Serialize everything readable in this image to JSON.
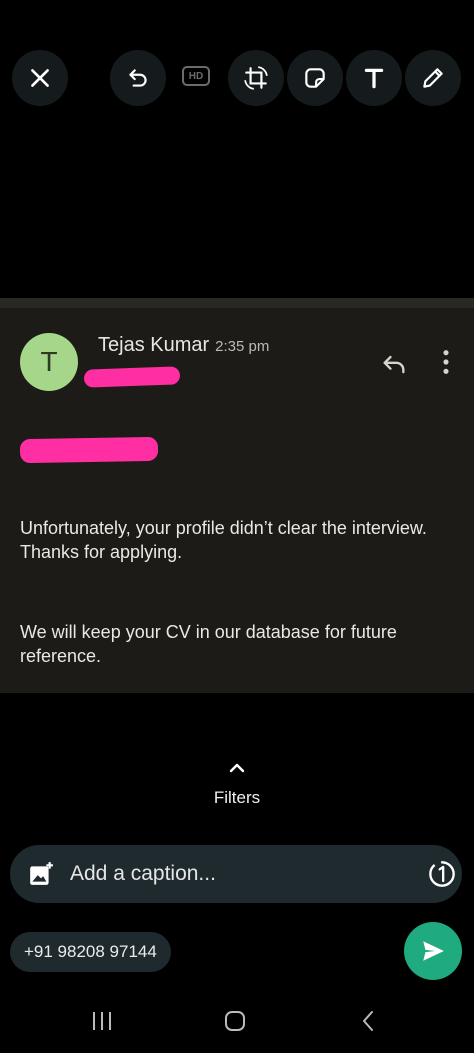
{
  "toolbar": {
    "hd_label": "HD"
  },
  "email": {
    "avatar_letter": "T",
    "sender_name": "Tejas Kumar",
    "time": "2:35 pm",
    "paragraph1": "Unfortunately, your profile didn’t clear the interview. Thanks for applying.",
    "paragraph2": "We will keep your CV in our database for future reference."
  },
  "filters": {
    "label": "Filters"
  },
  "caption": {
    "placeholder": "Add a caption..."
  },
  "recipient": {
    "label": "+91 98208 97144"
  },
  "colors": {
    "accent_send": "#1faa7f",
    "avatar": "#a5d68a",
    "redaction": "#ff2fa3"
  }
}
